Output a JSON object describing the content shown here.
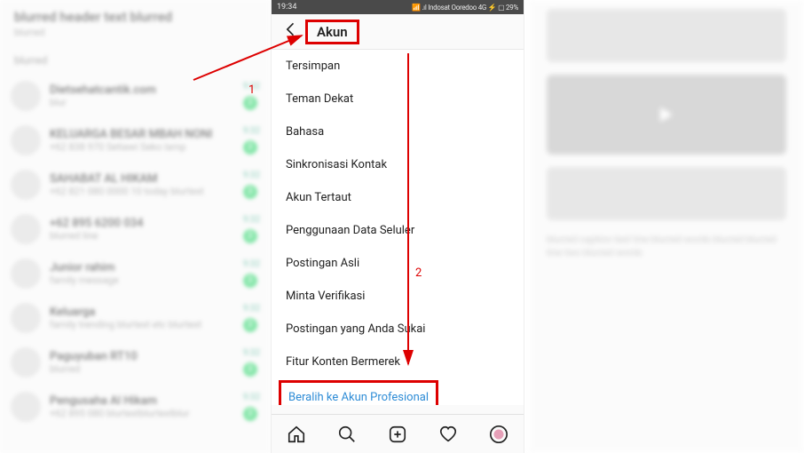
{
  "status_bar": {
    "time": "19:34",
    "carrier": "Indosat Ooredoo 4G",
    "battery": "29%"
  },
  "header": {
    "title": "Akun"
  },
  "menu": [
    "Tersimpan",
    "Teman Dekat",
    "Bahasa",
    "Sinkronisasi Kontak",
    "Akun Tertaut",
    "Penggunaan Data Seluler",
    "Postingan Asli",
    "Minta Verifikasi",
    "Postingan yang Anda Sukai",
    "Fitur Konten Bermerek"
  ],
  "switch_account": "Beralih ke Akun Profesional",
  "annotations": {
    "n1": "1",
    "n2": "2"
  },
  "left_panel": {
    "header_title": "blurred header text blurred",
    "header_sub": "blurred",
    "section": "blurred",
    "items": [
      {
        "name": "Dietsehatcantik.com",
        "msg": "blur"
      },
      {
        "name": "KELUARGA BESAR MBAH NONI",
        "msg": "+62 838  970  Setiawi Seko lamp"
      },
      {
        "name": "SAHABAT AL HIKAM",
        "msg": "+62 821 080 0000 10 today blurtext"
      },
      {
        "name": "+62 895 6200 034",
        "msg": "blurred line"
      },
      {
        "name": "Junior rahim",
        "msg": "family message"
      },
      {
        "name": "Keluarga",
        "msg": "family trending blurtext etc blurtext"
      },
      {
        "name": "Paguyuban RT10",
        "msg": "blurred"
      },
      {
        "name": "Pengusaha Al Hikam",
        "msg": "+62 895 080  blurtextblurtextblur"
      }
    ]
  },
  "right_panel": {
    "text": "blurred caption text line blurred words blurred blurred line two blurred words"
  }
}
